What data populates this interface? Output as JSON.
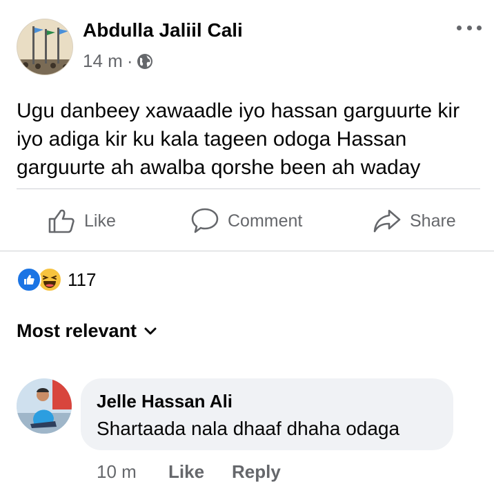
{
  "post": {
    "author": "Abdulla Jaliil Cali",
    "time": "14 m",
    "separator": "·",
    "audience_icon": "globe-icon",
    "body": "Ugu danbeey xawaadle iyo hassan garguurte kir iyo adiga kir ku kala tageen odoga Hassan garguurte ah awalba qorshe been ah waday"
  },
  "actions": {
    "like": "Like",
    "comment": "Comment",
    "share": "Share"
  },
  "reactions": {
    "icons": [
      "like-reaction-icon",
      "haha-reaction-icon"
    ],
    "count": "117"
  },
  "sort": {
    "label": "Most relevant"
  },
  "comment": {
    "author": "Jelle Hassan Ali",
    "text": "Shartaada nala dhaaf dhaha odaga",
    "time": "10 m",
    "like_label": "Like",
    "reply_label": "Reply"
  },
  "colors": {
    "text": "#050505",
    "secondary": "#65676b",
    "bubble": "#f0f2f5",
    "divider": "#ced0d4",
    "like_blue": "#1b74e4",
    "haha_yellow": "#f7c33f"
  }
}
